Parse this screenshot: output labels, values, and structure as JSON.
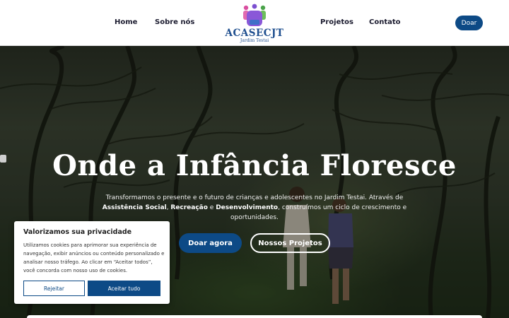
{
  "nav": {
    "home": "Home",
    "about": "Sobre nós",
    "projects": "Projetos",
    "contact": "Contato",
    "donate": "Doar"
  },
  "logo": {
    "title": "ACASECJT",
    "subtitle": "Jardim Testai"
  },
  "hero": {
    "title": "Onde a Infância Floresce",
    "text_1": "Transformamos o presente e o futuro de crianças e adolescentes no Jardim Testai. Através de ",
    "strong_1": "Assistência Social",
    "text_2": ", ",
    "strong_2": "Recreação",
    "text_3": " e ",
    "strong_3": "Desenvolvimento",
    "text_4": ", construímos um ciclo de crescimento e oportunidades.",
    "primary_button": "Doar agora",
    "secondary_button": "Nossos Projetos"
  },
  "cookie": {
    "title": "Valorizamos sua privacidade",
    "text": "Utilizamos cookies para aprimorar sua experiência de navegação, exibir anúncios ou conteúdo personalizado e analisar nosso tráfego. Ao clicar em “Aceitar todos”, você concorda com nosso uso de cookies.",
    "reject": "Rejeitar",
    "accept": "Aceitar tudo"
  },
  "colors": {
    "brand": "#0d4a86",
    "logo_text": "#1f4f8f"
  }
}
